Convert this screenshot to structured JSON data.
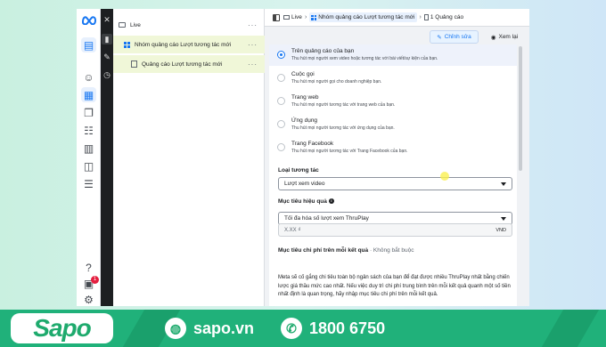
{
  "tree": {
    "items": [
      {
        "label": "Live"
      },
      {
        "label": "Nhóm quảng cáo Lượt tương tác mới"
      },
      {
        "label": "Quảng cáo Lượt tương tác mới"
      }
    ],
    "more_icon": "more-dots-icon"
  },
  "header": {
    "crumbs": [
      "Live",
      "Nhóm quảng cáo Lượt tương tác mới",
      "1 Quảng cáo"
    ],
    "edit_label": "Chỉnh sửa",
    "view_label": "Xem lại"
  },
  "options": [
    {
      "title": "Trên quảng cáo của bạn",
      "sub": "Thu hút mọi người xem video hoặc tương tác với bài viết/sự kiện của bạn.",
      "selected": true
    },
    {
      "title": "Cuộc gọi",
      "sub": "Thu hút mọi người gọi cho doanh nghiệp bạn.",
      "selected": false
    },
    {
      "title": "Trang web",
      "sub": "Thu hút mọi người tương tác với trang web của bạn.",
      "selected": false
    },
    {
      "title": "Ứng dụng",
      "sub": "Thu hút mọi người tương tác với ứng dụng của bạn.",
      "selected": false
    },
    {
      "title": "Trang Facebook",
      "sub": "Thu hút mọi người tương tác với Trang Facebook của bạn.",
      "selected": false
    }
  ],
  "interaction_type": {
    "label": "Loại tương tác",
    "value": "Lượt xem video"
  },
  "performance_goal": {
    "label": "Mục tiêu hiệu quả",
    "value": "Tối đa hóa số lượt xem ThruPlay"
  },
  "cost_goal": {
    "label": "Mục tiêu chi phí trên mỗi kết quả",
    "optional": "· Không bắt buộc",
    "placeholder": "X.XX ₫",
    "currency": "VND"
  },
  "description": "Meta sẽ cố gắng chi tiêu toàn bộ ngân sách của bạn để đạt được nhiều ThruPlay nhất bằng chiến lược giá thầu mức cao nhất. Nếu việc duy trì chi phí trung bình trên mỗi kết quả quanh một số tiền nhất định là quan trọng, hãy nhập mục tiêu chi phí trên mỗi kết quả.",
  "rail": {
    "badge": "1"
  },
  "footer": {
    "brand": "Sapo",
    "website": "sapo.vn",
    "phone": "1800 6750",
    "color": "#20b17a"
  }
}
